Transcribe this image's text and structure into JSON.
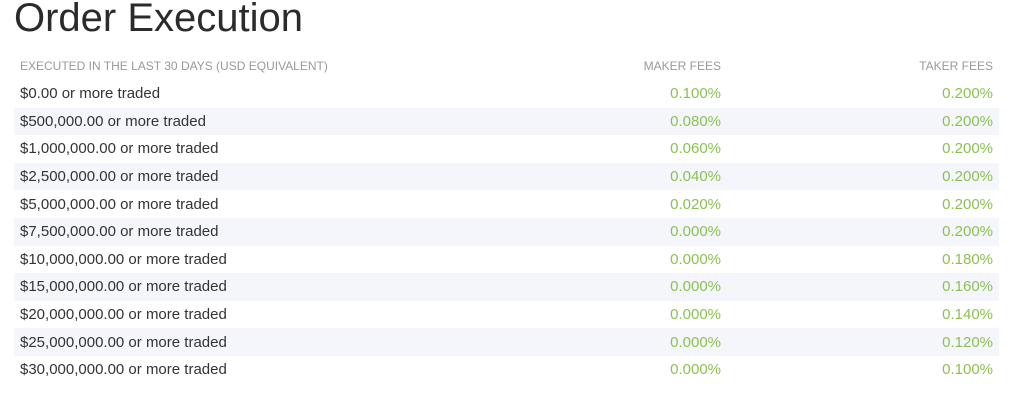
{
  "page": {
    "title": "Order Execution"
  },
  "table": {
    "headers": {
      "volume": "EXECUTED IN THE LAST 30 DAYS (USD EQUIVALENT)",
      "maker": "MAKER FEES",
      "taker": "TAKER FEES"
    },
    "rows": [
      {
        "volume": "$0.00 or more traded",
        "maker": "0.100%",
        "taker": "0.200%"
      },
      {
        "volume": "$500,000.00 or more traded",
        "maker": "0.080%",
        "taker": "0.200%"
      },
      {
        "volume": "$1,000,000.00 or more traded",
        "maker": "0.060%",
        "taker": "0.200%"
      },
      {
        "volume": "$2,500,000.00 or more traded",
        "maker": "0.040%",
        "taker": "0.200%"
      },
      {
        "volume": "$5,000,000.00 or more traded",
        "maker": "0.020%",
        "taker": "0.200%"
      },
      {
        "volume": "$7,500,000.00 or more traded",
        "maker": "0.000%",
        "taker": "0.200%"
      },
      {
        "volume": "$10,000,000.00 or more traded",
        "maker": "0.000%",
        "taker": "0.180%"
      },
      {
        "volume": "$15,000,000.00 or more traded",
        "maker": "0.000%",
        "taker": "0.160%"
      },
      {
        "volume": "$20,000,000.00 or more traded",
        "maker": "0.000%",
        "taker": "0.140%"
      },
      {
        "volume": "$25,000,000.00 or more traded",
        "maker": "0.000%",
        "taker": "0.120%"
      },
      {
        "volume": "$30,000,000.00 or more traded",
        "maker": "0.000%",
        "taker": "0.100%"
      }
    ]
  },
  "colors": {
    "fee_value": "#8cc152",
    "header_text": "#999999",
    "row_stripe": "#f4f6fb"
  }
}
